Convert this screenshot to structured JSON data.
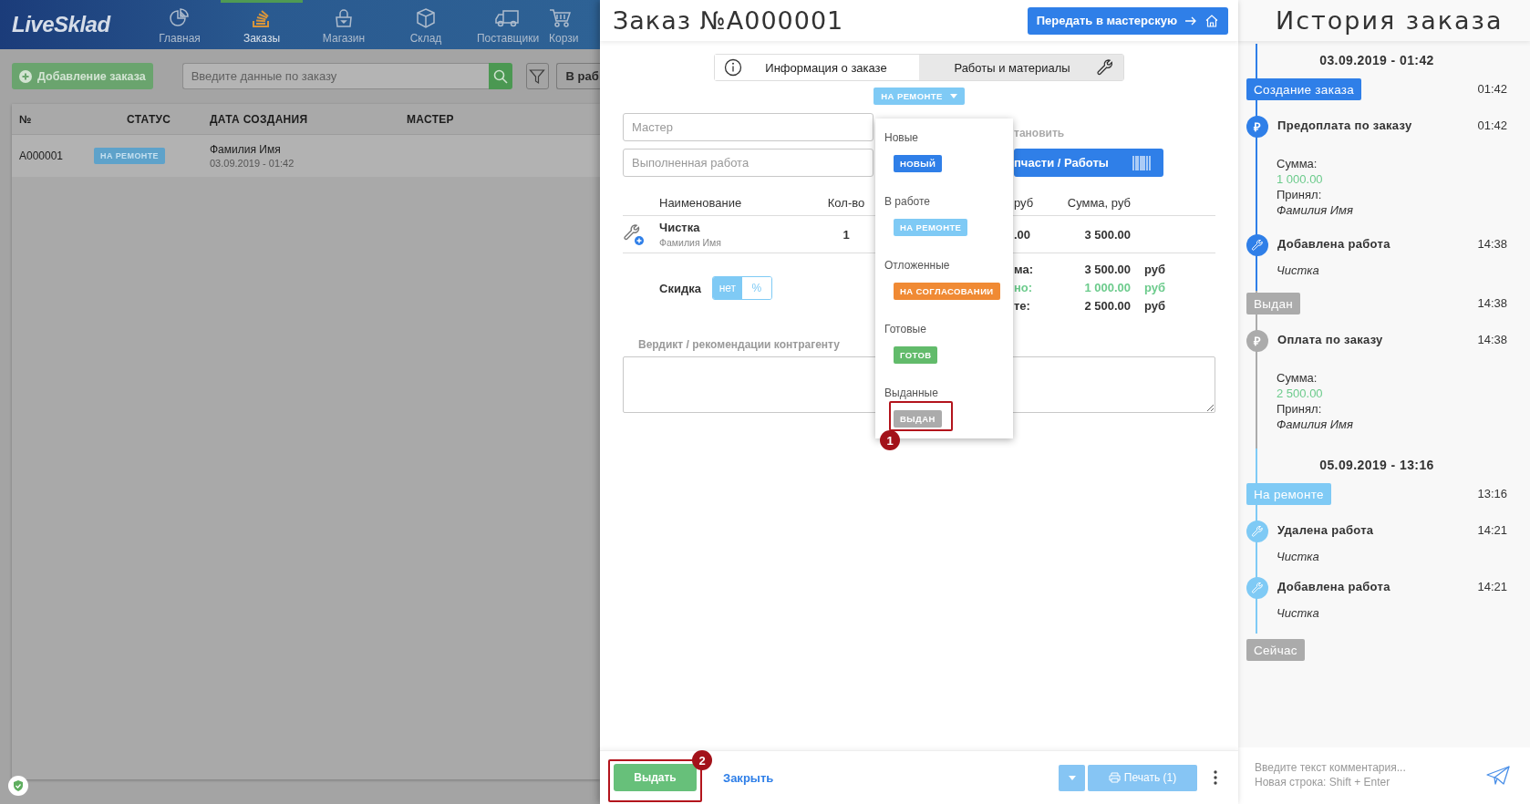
{
  "app": {
    "logo": "LiveSklad",
    "nav": [
      {
        "label": "Главная",
        "selected": false
      },
      {
        "label": "Заказы",
        "selected": true
      },
      {
        "label": "Магазин",
        "selected": false
      },
      {
        "label": "Склад",
        "selected": false
      },
      {
        "label": "Поставщики",
        "selected": false
      },
      {
        "label": "Корзи",
        "selected": false
      }
    ],
    "add_button": "Добавление заказа",
    "search": {
      "placeholder": "Введите данные по заказу"
    },
    "status_filter": "В раб",
    "table": {
      "columns": [
        "№",
        "СТАТУС",
        "ДАТА СОЗДАНИЯ",
        "МАСТЕР"
      ],
      "rows": [
        {
          "number": "A000001",
          "status": "НА РЕМОНТЕ",
          "name": "Фамилия Имя",
          "date": "03.09.2019 - 01:42"
        }
      ]
    }
  },
  "order": {
    "title": "Заказ №A000001",
    "transfer_button": "Передать в мастерскую",
    "tabs": [
      {
        "label": "Информация о заказе",
        "selected": false
      },
      {
        "label": "Работы и материалы",
        "selected": true
      }
    ],
    "status": "НА РЕМОНТЕ",
    "fields": [
      {
        "placeholder": "Мастер"
      },
      {
        "placeholder": "Выполненная работа"
      }
    ],
    "install_label": "тановить",
    "parts_button": "пчасти / Работы",
    "works": {
      "columns": [
        "Наименование",
        "Кол-во",
        "руб",
        "Сумма, руб"
      ],
      "rows": [
        {
          "name": "Чистка",
          "performer": "Фамилия Имя",
          "qty": "1",
          "price": ".00",
          "sum": "3 500.00"
        }
      ]
    },
    "discount": {
      "label": "Скидка",
      "options": [
        {
          "label": "нет",
          "selected": true
        },
        {
          "label": "%",
          "selected": false
        }
      ]
    },
    "totals": [
      {
        "label": "ма:",
        "value": "3 500.00",
        "currency": "руб",
        "kind": "plain"
      },
      {
        "label": "но:",
        "value": "1 000.00",
        "currency": "руб",
        "kind": "paid"
      },
      {
        "label": "те:",
        "value": "2 500.00",
        "currency": "руб",
        "kind": "plain"
      }
    ],
    "verdict": {
      "label": "Вердикт / рекомендации контрагенту"
    },
    "footer": {
      "issue_button": "Выдать",
      "close_link": "Закрыть",
      "print_button": "Печать (1)"
    }
  },
  "status_menu": {
    "groups": [
      {
        "label": "Новые",
        "status": "НОВЫЙ",
        "color": "#2f7fe8"
      },
      {
        "label": "В работе",
        "status": "НА РЕМОНТЕ",
        "color": "#7fcaf5"
      },
      {
        "label": "Отложенные",
        "status": "НА СОГЛАСОВАНИИ",
        "color": "#f08a34"
      },
      {
        "label": "Готовые",
        "status": "ГОТОВ",
        "color": "#62bb6b"
      },
      {
        "label": "Выданные",
        "status": "ВЫДАН",
        "color": "#ababab"
      }
    ]
  },
  "annotations": [
    {
      "number": "1"
    },
    {
      "number": "2"
    }
  ],
  "history": {
    "title": "История заказа",
    "items": [
      {
        "kind": "date",
        "text": "03.09.2019 - 01:42"
      },
      {
        "kind": "status",
        "label": "Создание заказа",
        "time": "01:42",
        "color": "#2f7fe8"
      },
      {
        "kind": "event",
        "symbol": "₽",
        "color": "#2f7fe8",
        "title": "Предоплата по заказу",
        "time": "01:42",
        "details": [
          {
            "kind": "label",
            "text": "Сумма:"
          },
          {
            "kind": "amount",
            "text": "1 000.00"
          },
          {
            "kind": "label",
            "text": "Принял:"
          },
          {
            "kind": "note",
            "text": "Фамилия Имя"
          }
        ]
      },
      {
        "kind": "event",
        "color": "#2f7fe8",
        "title": "Добавлена работа",
        "time": "14:38",
        "details": [
          {
            "kind": "note",
            "text": "Чистка"
          }
        ]
      },
      {
        "kind": "status",
        "label": "Выдан",
        "time": "14:38",
        "color": "#ababab"
      },
      {
        "kind": "event",
        "symbol": "₽",
        "color": "#ababab",
        "title": "Оплата по заказу",
        "time": "14:38",
        "details": [
          {
            "kind": "label",
            "text": "Сумма:"
          },
          {
            "kind": "amount",
            "text": "2 500.00"
          },
          {
            "kind": "label",
            "text": "Принял:"
          },
          {
            "kind": "note",
            "text": "Фамилия Имя"
          }
        ]
      },
      {
        "kind": "date",
        "text": "05.09.2019 - 13:16"
      },
      {
        "kind": "status",
        "label": "На ремонте",
        "time": "13:16",
        "color": "#7fcaf5"
      },
      {
        "kind": "event",
        "color": "#7fcaf5",
        "title": "Удалена работа",
        "time": "14:21",
        "details": [
          {
            "kind": "note",
            "text": "Чистка"
          }
        ]
      },
      {
        "kind": "event",
        "color": "#7fcaf5",
        "title": "Добавлена работа",
        "time": "14:21",
        "details": [
          {
            "kind": "note",
            "text": "Чистка"
          }
        ]
      },
      {
        "kind": "end",
        "label": "Сейчас",
        "color": "#ababab"
      }
    ],
    "comment": {
      "placeholder": "Введите текст комментария...\nНовая строка: Shift + Enter"
    }
  }
}
